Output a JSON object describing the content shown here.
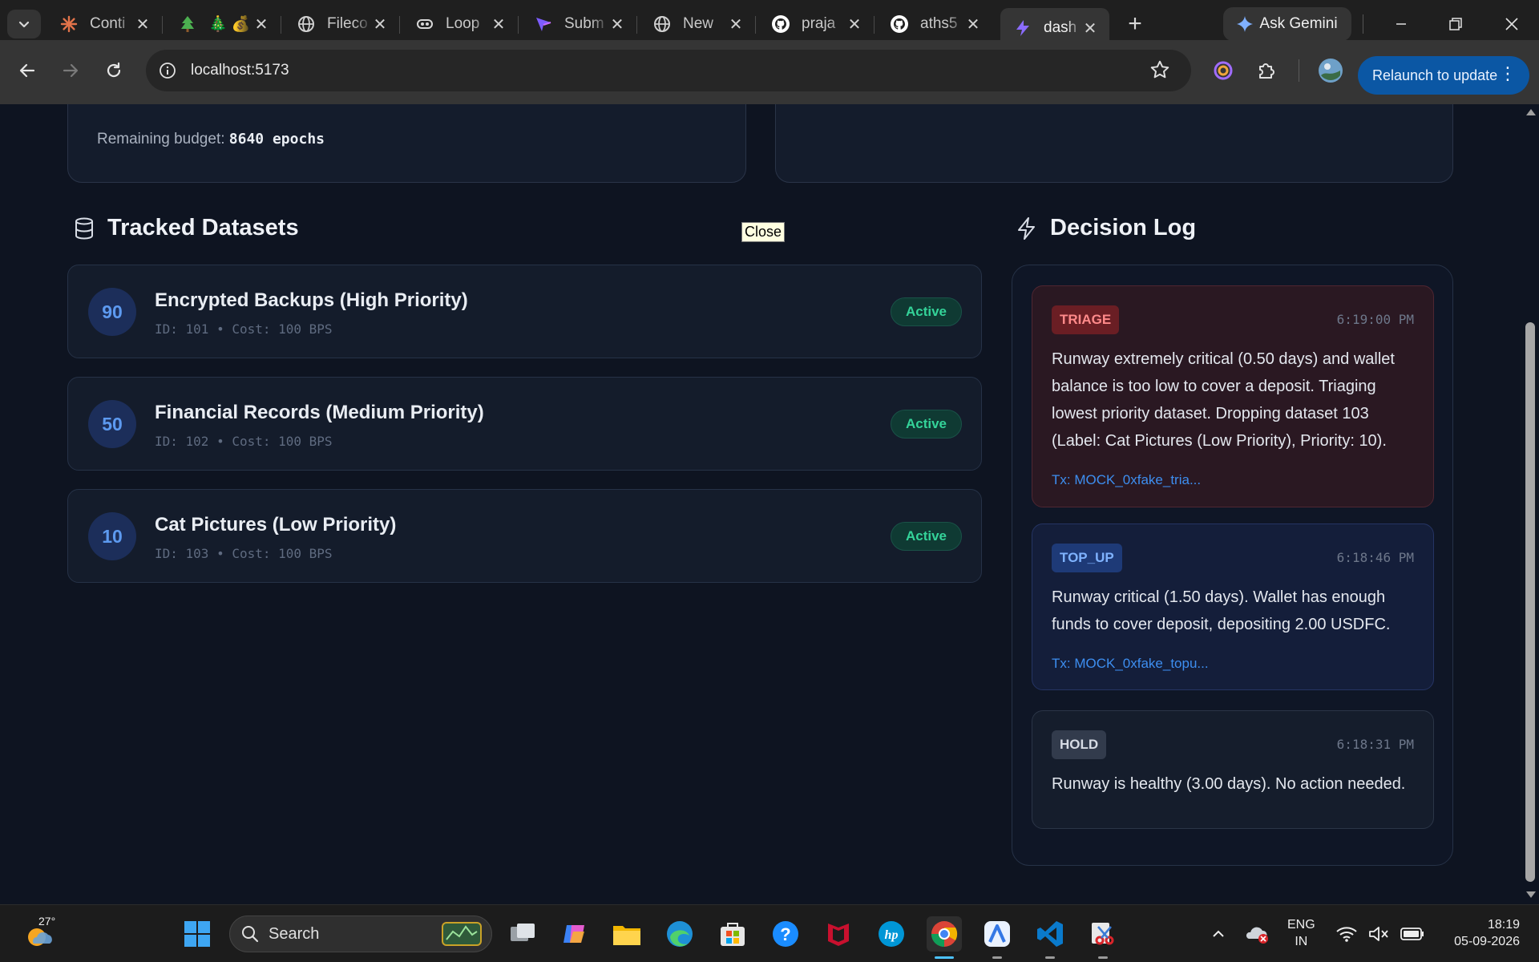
{
  "browser": {
    "tabs": [
      {
        "label": "Conti",
        "icon": "asterisk-icon",
        "color": "#e2734a"
      },
      {
        "label": "🎄 💰 Fi",
        "icon": "tree-icon",
        "color": "#4caf50"
      },
      {
        "label": "Fileco",
        "icon": "globe-icon",
        "color": "#d0d0d0"
      },
      {
        "label": "Loop",
        "icon": "loop-icon",
        "color": "#d0d0d0"
      },
      {
        "label": "Subm",
        "icon": "submit-icon",
        "color": "#7c5cff"
      },
      {
        "label": "New",
        "icon": "globe-icon",
        "color": "#d0d0d0"
      },
      {
        "label": "praja",
        "icon": "github-icon",
        "color": "#ffffff"
      },
      {
        "label": "aths5",
        "icon": "github-icon",
        "color": "#ffffff"
      },
      {
        "label": "dash",
        "icon": "bolt-icon",
        "color": "#8b6cff",
        "active": true
      }
    ],
    "new_tab_label": "+",
    "gemini_label": "Ask Gemini",
    "url": "localhost:5173",
    "relaunch_label": "Relaunch to update"
  },
  "page": {
    "budget_label": "Remaining budget:",
    "budget_value": "8640 epochs",
    "tooltip": "Close",
    "datasets_title": "Tracked Datasets",
    "datasets": [
      {
        "priority": "90",
        "name": "Encrypted Backups (High Priority)",
        "meta": "ID: 101 • Cost: 100 BPS",
        "status": "Active"
      },
      {
        "priority": "50",
        "name": "Financial Records (Medium Priority)",
        "meta": "ID: 102 • Cost: 100 BPS",
        "status": "Active"
      },
      {
        "priority": "10",
        "name": "Cat Pictures (Low Priority)",
        "meta": "ID: 103 • Cost: 100 BPS",
        "status": "Active"
      }
    ],
    "log_title": "Decision Log",
    "log": [
      {
        "type": "TRIAGE",
        "time": "6:19:00 PM",
        "text": "Runway extremely critical (0.50 days) and wallet balance is too low to cover a deposit. Triaging lowest priority dataset. Dropping dataset 103 (Label: Cat Pictures (Low Priority), Priority: 10).",
        "tx": "Tx: MOCK_0xfake_tria..."
      },
      {
        "type": "TOP_UP",
        "time": "6:18:46 PM",
        "text": "Runway critical (1.50 days). Wallet has enough funds to cover deposit, depositing 2.00 USDFC.",
        "tx": "Tx: MOCK_0xfake_topu..."
      },
      {
        "type": "HOLD",
        "time": "6:18:31 PM",
        "text": "Runway is healthy (3.00 days). No action needed."
      }
    ]
  },
  "taskbar": {
    "temperature": "27°",
    "search_placeholder": "Search",
    "lang_line1": "ENG",
    "lang_line2": "IN",
    "time": "18:19",
    "date": "05-09-2026"
  },
  "colors": {
    "page_bg": "#0e1421",
    "active_green": "#34d399",
    "triage_red": "#ff8a8a",
    "topup_blue": "#7fb3ff",
    "link_blue": "#3d8ef0"
  }
}
